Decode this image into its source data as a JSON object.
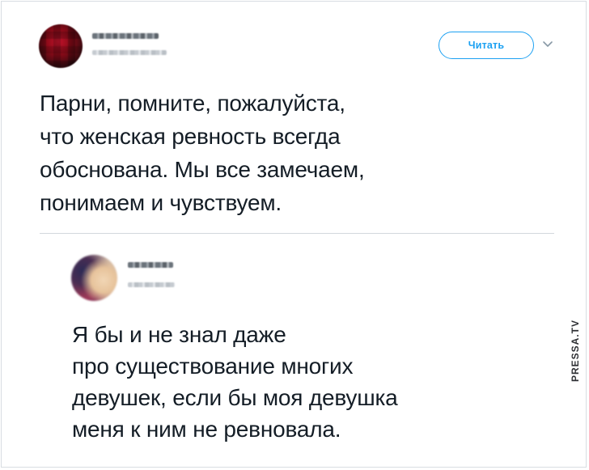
{
  "tweet": {
    "author": {
      "avatar_icon": "avatar-icon"
    },
    "follow_label": "Читать",
    "text": "Парни, помните, пожалуйста,\nчто женская ревность всегда\nобоснована. Мы все замечаем,\nпонимаем и чувствуем."
  },
  "reply": {
    "author": {
      "avatar_icon": "avatar-icon"
    },
    "text": "Я бы и не знал даже\nпро существование многих\nдевушек, если бы моя девушка\nменя к ним не ревновала."
  },
  "watermark": "PRESSA.TV",
  "colors": {
    "accent": "#1da1f2",
    "text": "#141d26",
    "divider": "#d3d8dd"
  }
}
